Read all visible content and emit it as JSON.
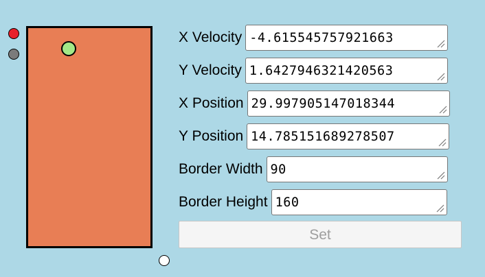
{
  "colors": {
    "background": "#add8e6",
    "playfield": "#e87e55",
    "ball": "#a3e887",
    "indicator_red": "#e8202a",
    "indicator_gray": "#7b7b7b",
    "indicator_white": "#ffffff"
  },
  "form": {
    "x_velocity": {
      "label": "X Velocity",
      "value": "-4.615545757921663"
    },
    "y_velocity": {
      "label": "Y Velocity",
      "value": "1.6427946321420563"
    },
    "x_position": {
      "label": "X Position",
      "value": "29.997905147018344"
    },
    "y_position": {
      "label": "Y Position",
      "value": "14.785151689278507"
    },
    "border_width": {
      "label": "Border Width",
      "value": "90"
    },
    "border_height": {
      "label": "Border Height",
      "value": "160"
    },
    "set_label": "Set"
  }
}
